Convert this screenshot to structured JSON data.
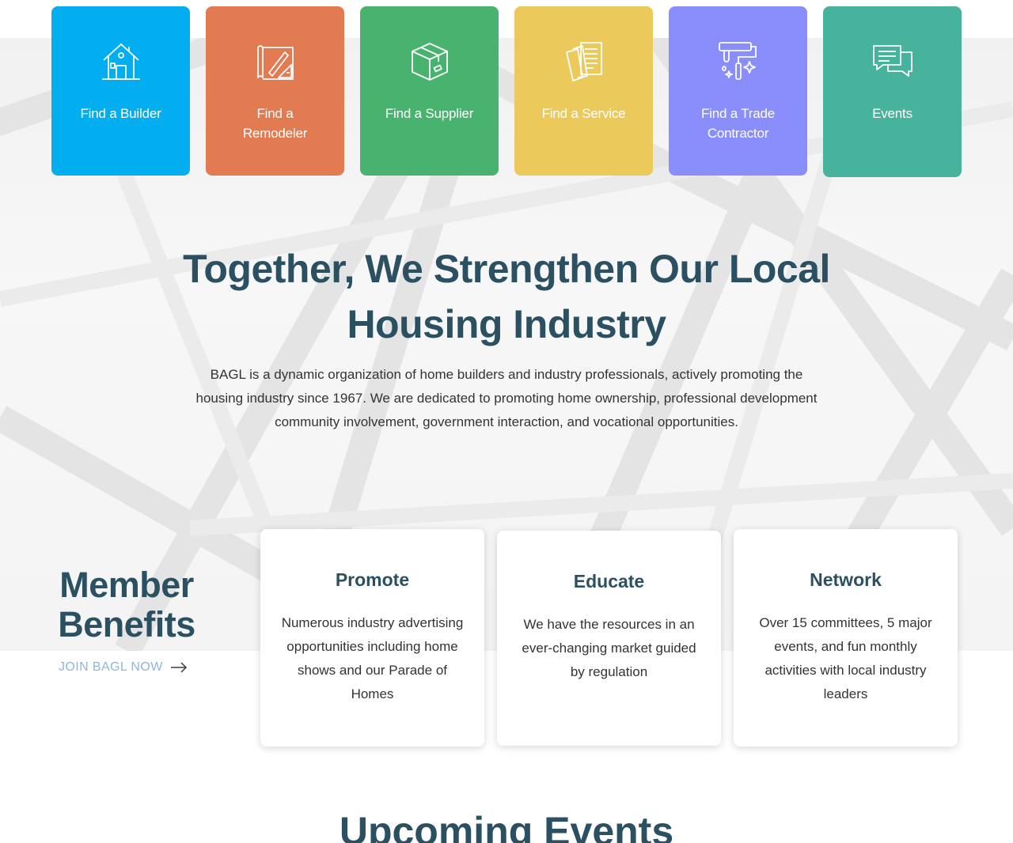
{
  "tiles": [
    {
      "label": "Find a Builder",
      "color": "#02aeef",
      "icon": "house-icon"
    },
    {
      "label": "Find a Remodeler",
      "color": "#e27b51",
      "icon": "blueprint-icon"
    },
    {
      "label": "Find a Supplier",
      "color": "#48b36e",
      "icon": "box-icon"
    },
    {
      "label": "Find a Service",
      "color": "#ecc95b",
      "icon": "documents-icon"
    },
    {
      "label": "Find a Trade Contractor",
      "color": "#8a8dfc",
      "icon": "paint-roller-icon"
    },
    {
      "label": "Events",
      "color": "#48b39c",
      "icon": "chat-bubbles-icon"
    }
  ],
  "hero": {
    "title": "Together, We Strengthen Our Local Housing Industry",
    "text": "BAGL is a dynamic organization of home builders and industry professionals, actively promoting the housing industry since 1967. We are dedicated to promoting home ownership, professional development community involvement, government interaction, and vocational opportunities."
  },
  "member_benefits": {
    "title": "Member Benefits",
    "link": "JOIN BAGL NOW",
    "link_icon": "arrow-right-icon"
  },
  "cards": [
    {
      "title": "Promote",
      "text": "Numerous industry advertising opportunities including home shows and our Parade of Homes"
    },
    {
      "title": "Educate",
      "text": "We have the resources in an ever-changing market guided by regulation"
    },
    {
      "title": "Network",
      "text": "Over 15 committees, 5 major events, and fun monthly activities with local industry leaders"
    }
  ],
  "events": {
    "title": "Upcoming Events"
  },
  "colors": {
    "heading": "#2b5061",
    "link": "#8fb5dc"
  }
}
